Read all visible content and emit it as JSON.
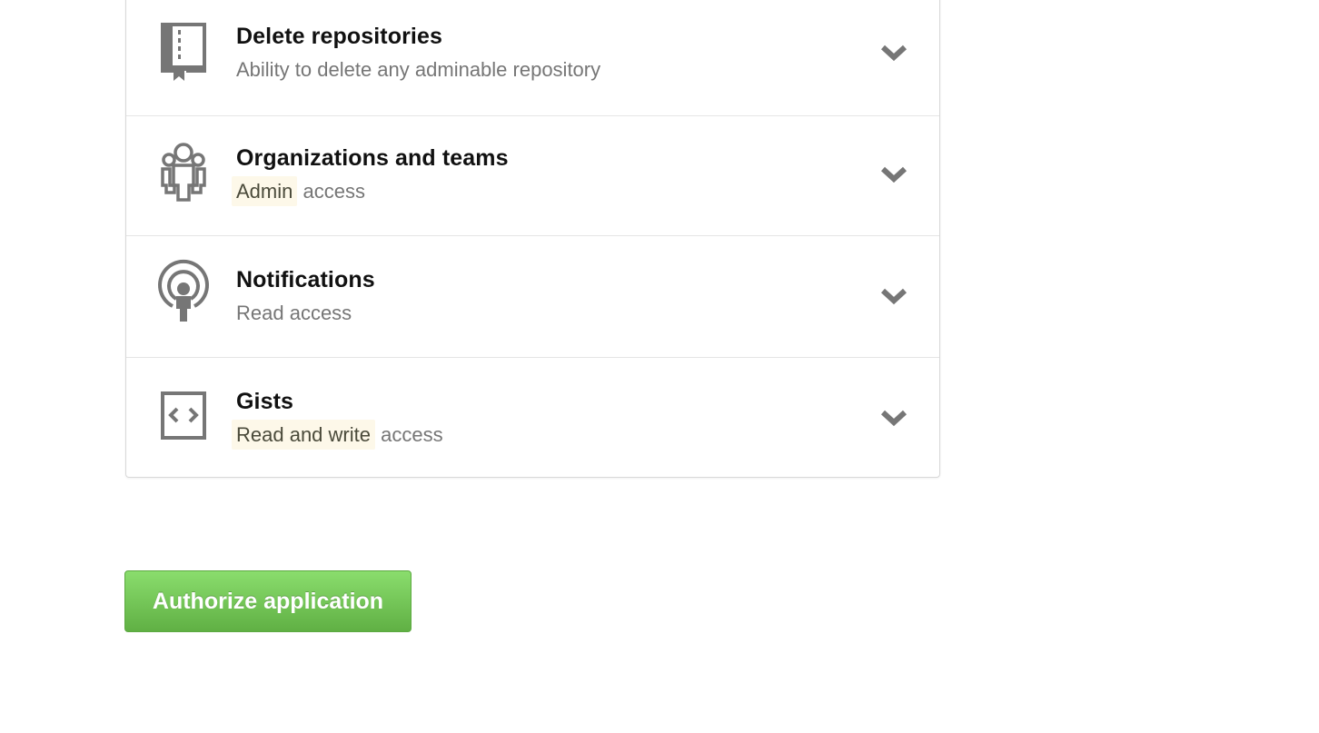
{
  "permissions": [
    {
      "title": "Delete repositories",
      "description": "Ability to delete any adminable repository",
      "icon": "repo-book-icon"
    },
    {
      "title": "Organizations and teams",
      "access_level": "Admin",
      "access_suffix": "access",
      "icon": "organization-people-icon"
    },
    {
      "title": "Notifications",
      "description": "Read access",
      "icon": "broadcast-icon"
    },
    {
      "title": "Gists",
      "access_level": "Read and write",
      "access_suffix": "access",
      "icon": "code-brackets-icon"
    }
  ],
  "authorize_button": {
    "label": "Authorize application"
  },
  "colors": {
    "button_green": "#60b044",
    "highlight": "#fdf8e9",
    "icon_gray": "#767676"
  }
}
